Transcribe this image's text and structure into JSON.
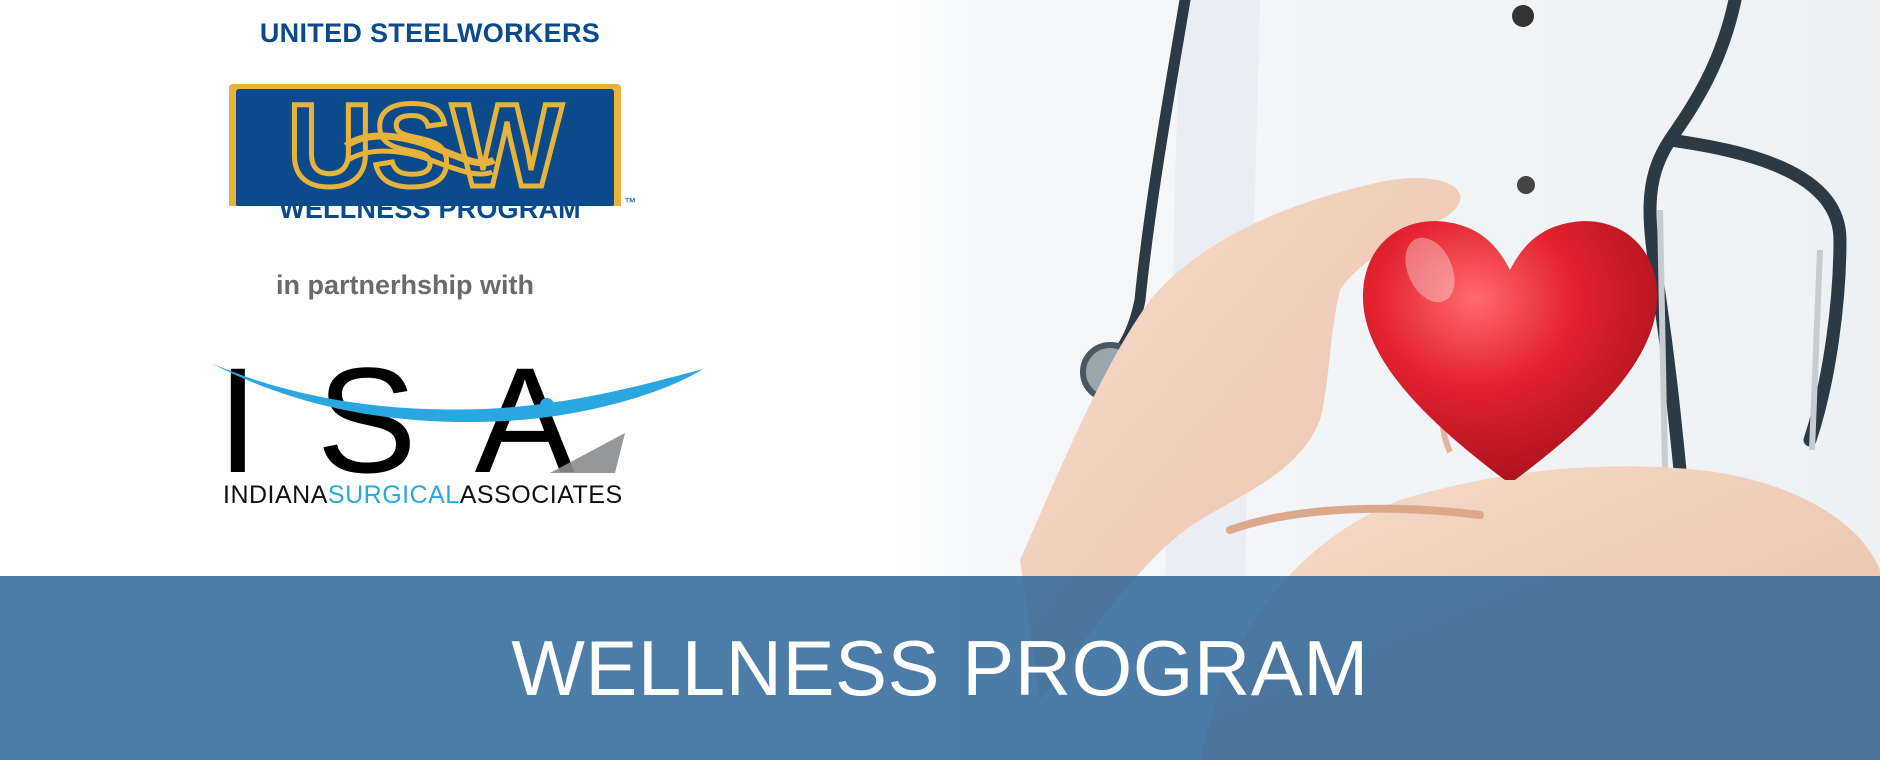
{
  "usw_logo": {
    "top_text": "UNITED STEELWORKERS",
    "mark_text": "USW",
    "trademark": "™",
    "bottom_text": "WELLNESS PROGRAM"
  },
  "partnership_text": "in partnerhship with",
  "isa_logo": {
    "letters": "ISA",
    "subtitle_part1": "INDIANA",
    "subtitle_part2": "SURGICAL",
    "subtitle_part3": "ASSOCIATES"
  },
  "banner": {
    "title": "WELLNESS PROGRAM"
  },
  "colors": {
    "usw_blue": "#0b4a8b",
    "usw_gold": "#e8b33a",
    "isa_blue": "#2aa7e1",
    "banner_blue": "#2f689a",
    "heart_red": "#e3222f"
  }
}
